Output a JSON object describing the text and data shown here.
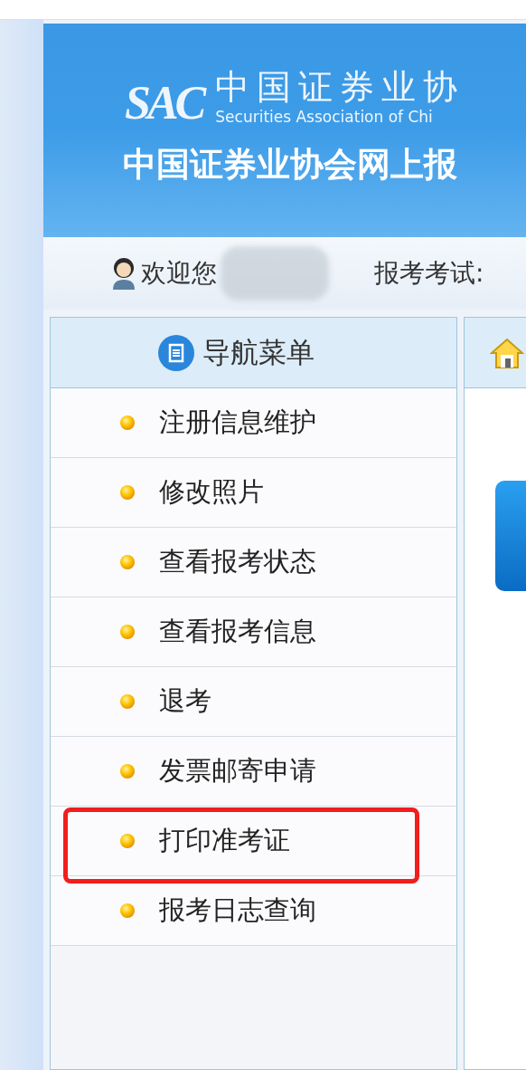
{
  "banner": {
    "logo_mark": "SAC",
    "logo_cn": "中国证券业协",
    "logo_en": "Securities Association of Chi",
    "title": "中国证券业协会网上报"
  },
  "welcome_bar": {
    "greeting": "欢迎您",
    "exam_label": "报考考试:"
  },
  "nav_menu": {
    "title": "导航菜单",
    "items": [
      {
        "label": "注册信息维护",
        "highlighted": false
      },
      {
        "label": "修改照片",
        "highlighted": false
      },
      {
        "label": "查看报考状态",
        "highlighted": false
      },
      {
        "label": "查看报考信息",
        "highlighted": false
      },
      {
        "label": "退考",
        "highlighted": false
      },
      {
        "label": "发票邮寄申请",
        "highlighted": false
      },
      {
        "label": "打印准考证",
        "highlighted": true
      },
      {
        "label": "报考日志查询",
        "highlighted": false
      }
    ]
  }
}
